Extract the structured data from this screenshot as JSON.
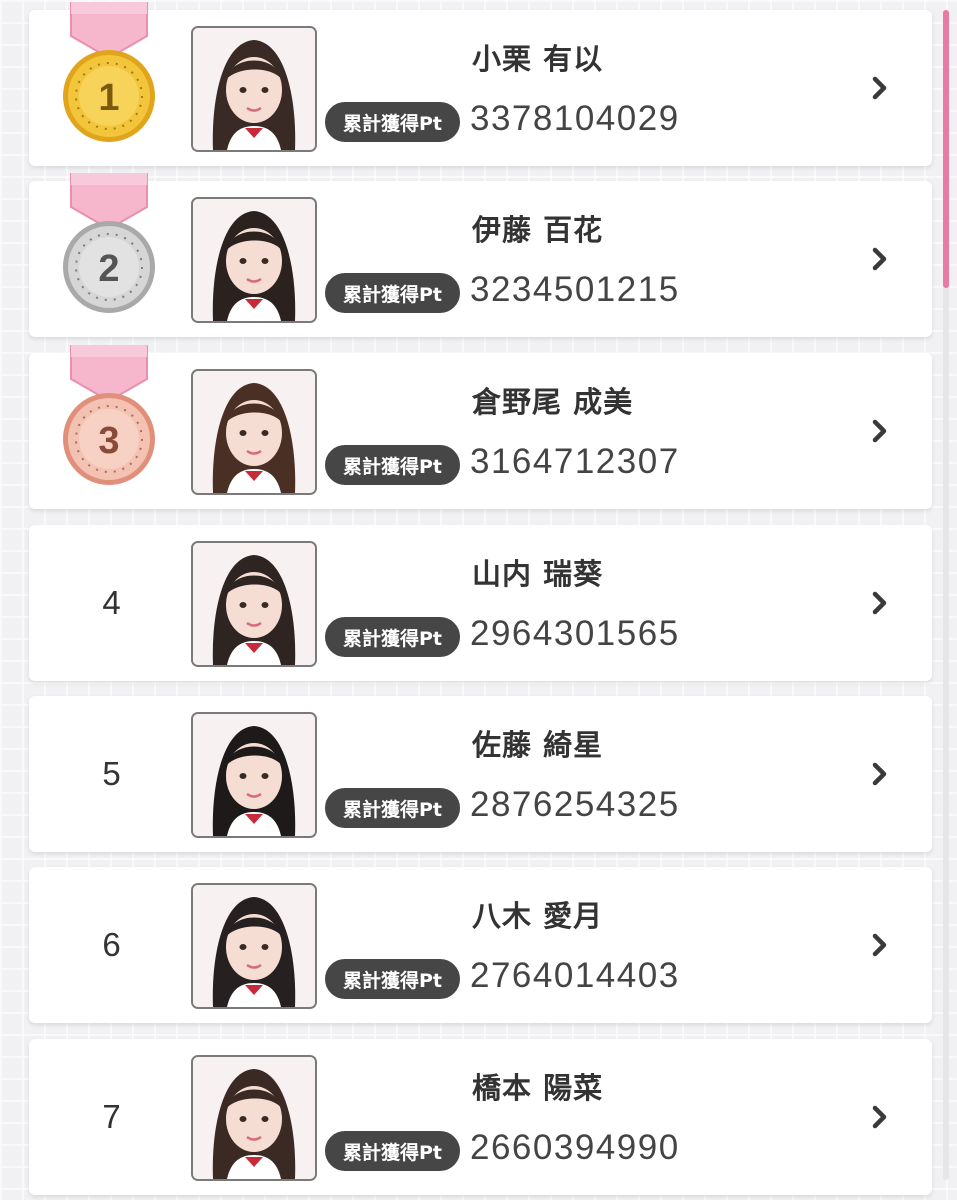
{
  "ranking": {
    "badge_label": "累計獲得Pt",
    "entries": [
      {
        "rank": "1",
        "name": "小栗 有以",
        "points": "3378104029",
        "medal": "gold"
      },
      {
        "rank": "2",
        "name": "伊藤 百花",
        "points": "3234501215",
        "medal": "silver"
      },
      {
        "rank": "3",
        "name": "倉野尾 成美",
        "points": "3164712307",
        "medal": "bronze"
      },
      {
        "rank": "4",
        "name": "山内 瑞葵",
        "points": "2964301565",
        "medal": ""
      },
      {
        "rank": "5",
        "name": "佐藤 綺星",
        "points": "2876254325",
        "medal": ""
      },
      {
        "rank": "6",
        "name": "八木 愛月",
        "points": "2764014403",
        "medal": ""
      },
      {
        "rank": "7",
        "name": "橋本 陽菜",
        "points": "2660394990",
        "medal": ""
      }
    ]
  },
  "colors": {
    "accent": "#e97aa3",
    "badge_bg": "#464646",
    "gold": "#f3c53a",
    "silver": "#c9c9c9",
    "bronze": "#f1b3a1"
  },
  "icons": {
    "row_action": "chevron-right-icon",
    "rank_1_3": "medal-icon"
  }
}
